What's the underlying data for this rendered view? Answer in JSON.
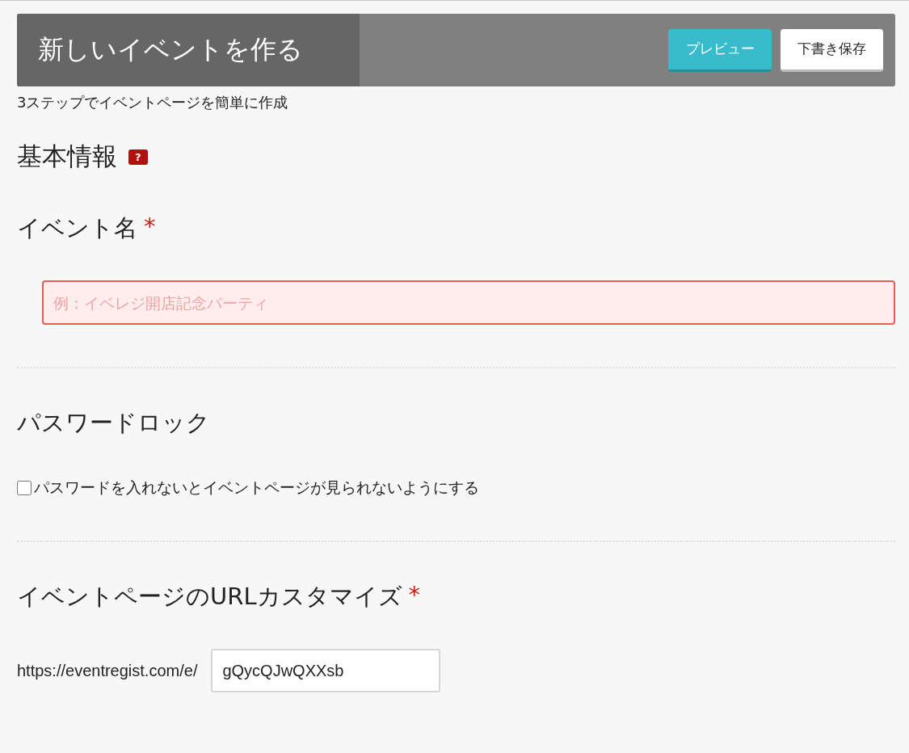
{
  "header": {
    "title": "新しいイベントを作る",
    "buttons": [
      {
        "label": "プレビュー",
        "kind": "primary"
      },
      {
        "label": "下書き保存",
        "kind": "secondary"
      }
    ]
  },
  "subtitle": "3ステップでイベントページを簡単に作成",
  "section": {
    "title": "基本情報",
    "help": "?"
  },
  "fields": [
    {
      "kind": "text",
      "label": "イベント名",
      "required_mark": "*",
      "placeholder": "例：イベレジ開店記念パーティ",
      "invalid": true
    },
    {
      "kind": "checkbox",
      "label": "パスワードロック",
      "option": "パスワードを入れないとイベントページが見られないようにする",
      "checked": false
    },
    {
      "kind": "url",
      "label": "イベントページのURLカスタマイズ",
      "required_mark": "*",
      "prefix": "https://eventregist.com/e/",
      "value": "gQycQJwQXXsb"
    }
  ]
}
